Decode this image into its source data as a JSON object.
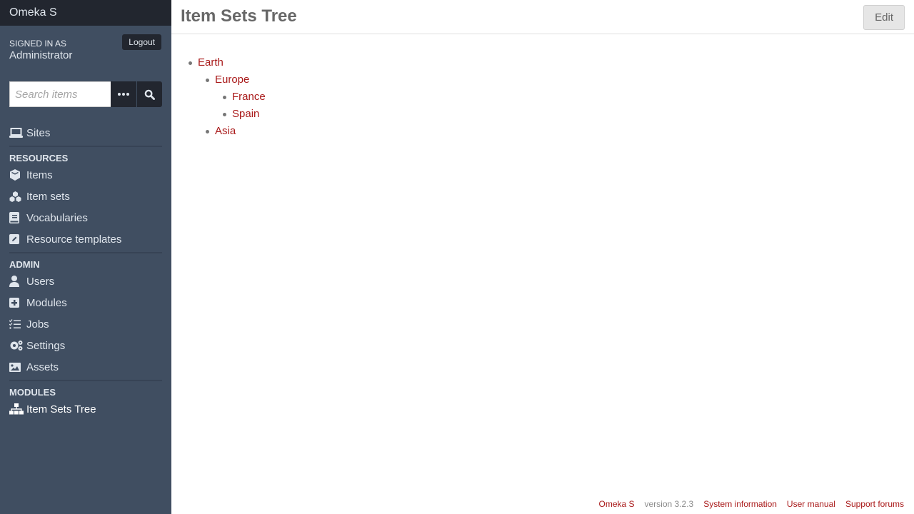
{
  "app": {
    "title": "Omeka S"
  },
  "user": {
    "signed_in_label": "Signed in as",
    "name": "Administrator",
    "logout_label": "Logout"
  },
  "search": {
    "placeholder": "Search items",
    "value": ""
  },
  "nav": {
    "sites": "Sites",
    "resources_heading": "Resources",
    "resources": [
      "Items",
      "Item sets",
      "Vocabularies",
      "Resource templates"
    ],
    "admin_heading": "Admin",
    "admin": [
      "Users",
      "Modules",
      "Jobs",
      "Settings",
      "Assets"
    ],
    "modules_heading": "Modules",
    "modules": [
      "Item Sets Tree"
    ]
  },
  "header": {
    "title": "Item Sets Tree",
    "edit_label": "Edit"
  },
  "tree": {
    "earth": "Earth",
    "europe": "Europe",
    "france": "France",
    "spain": "Spain",
    "asia": "Asia"
  },
  "footer": {
    "app_link": "Omeka S",
    "version": "version 3.2.3",
    "system_info": "System information",
    "user_manual": "User manual",
    "support_forums": "Support forums"
  },
  "colors": {
    "link": "#a91919",
    "sidebar": "#404e61",
    "sidebar_dark": "#22262f"
  }
}
